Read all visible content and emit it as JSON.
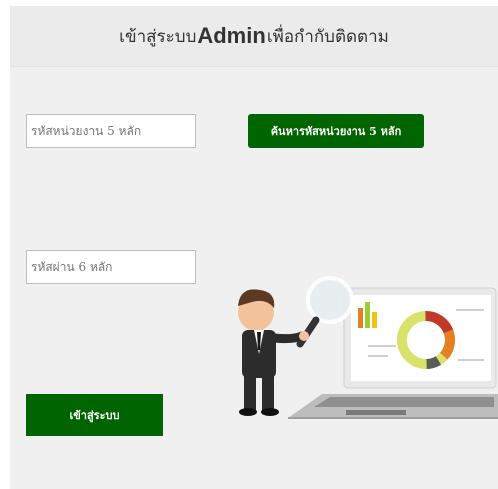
{
  "header": {
    "title_prefix": "เข้าสู่ระบบ",
    "title_brand": "Admin",
    "title_suffix": "เพื่อกำกับติดตาม"
  },
  "form": {
    "unit_code": {
      "placeholder": "รหัสหน่วยงาน 5 หลัก",
      "value": ""
    },
    "search_button_label": "ค้นหารหัสหน่วยงาน 5 หลัก",
    "password": {
      "placeholder": "รหัสผ่าน 6 หลัก",
      "value": ""
    },
    "login_button_label": "เข้าสู่ระบบ"
  },
  "colors": {
    "accent": "#006400",
    "panel_bg": "#f0f0f0",
    "header_bg": "#ebebeb"
  },
  "illustration": {
    "icons": [
      "businessman-icon",
      "magnifier-icon",
      "laptop-icon",
      "donut-chart-icon"
    ]
  }
}
